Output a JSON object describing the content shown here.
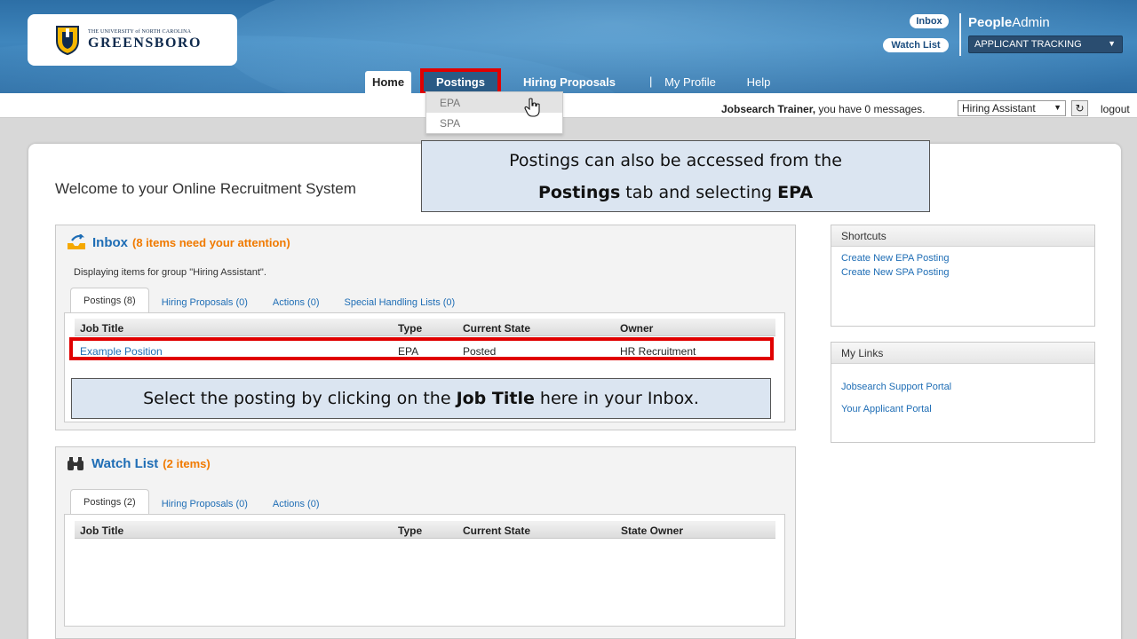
{
  "header": {
    "logo_small": "THE UNIVERSITY of NORTH CAROLINA",
    "logo_big": "GREENSBORO",
    "inbox_label": "Inbox",
    "watchlist_label": "Watch List",
    "brand_bold": "People",
    "brand_rest": "Admin",
    "app_selector": "APPLICANT TRACKING",
    "colors": {
      "header_blue": "#3f86bd",
      "highlight_red": "#e00000"
    }
  },
  "nav": {
    "tabs": [
      {
        "label": "Home"
      },
      {
        "label": "Postings"
      },
      {
        "label": "Hiring Proposals"
      },
      {
        "label": "My Profile"
      },
      {
        "label": "Help"
      }
    ],
    "separator": "|"
  },
  "postings_menu": {
    "items": [
      {
        "label": "EPA"
      },
      {
        "label": "SPA"
      }
    ]
  },
  "userbar": {
    "user_name": "Jobsearch Trainer,",
    "message_text": " you have 0 messages.",
    "role": "Hiring Assistant",
    "refresh_glyph": "↻",
    "logout": "logout"
  },
  "page": {
    "welcome": "Welcome to your Online Recruitment System"
  },
  "callouts": {
    "postings_tip": {
      "line1": "Postings can also be accessed from the",
      "bold1": "Postings",
      "mid": " tab and selecting ",
      "bold2": "EPA"
    },
    "inbox_tip": {
      "pre": "Select the posting by clicking on the ",
      "bold": "Job Title",
      "post": " here in your Inbox."
    }
  },
  "inbox": {
    "title": "Inbox",
    "count": "(8 items need your attention)",
    "display_text": "Displaying items for group \"Hiring Assistant\".",
    "tabs": [
      {
        "label": "Postings (8)"
      },
      {
        "label": "Hiring Proposals (0)"
      },
      {
        "label": "Actions (0)"
      },
      {
        "label": "Special Handling Lists (0)"
      }
    ],
    "columns": [
      "Job Title",
      "Type",
      "Current State",
      "Owner"
    ],
    "rows": [
      {
        "job_title": "Example Position",
        "type": "EPA",
        "state": "Posted",
        "owner": "HR Recruitment"
      }
    ]
  },
  "watchlist": {
    "title": "Watch List",
    "count": "(2 items)",
    "tabs": [
      {
        "label": "Postings (2)"
      },
      {
        "label": "Hiring Proposals (0)"
      },
      {
        "label": "Actions (0)"
      }
    ],
    "columns": [
      "Job Title",
      "Type",
      "Current State",
      "State Owner"
    ]
  },
  "shortcuts": {
    "title": "Shortcuts",
    "links": [
      {
        "label": "Create New EPA Posting"
      },
      {
        "label": "Create New SPA Posting"
      }
    ]
  },
  "my_links": {
    "title": "My Links",
    "links": [
      {
        "label": "Jobsearch Support Portal"
      },
      {
        "label": "Your Applicant Portal"
      }
    ]
  }
}
